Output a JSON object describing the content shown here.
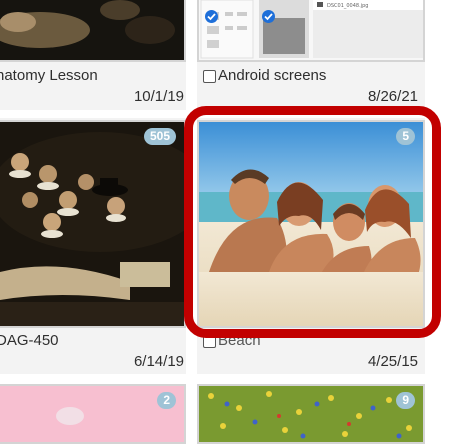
{
  "albums": [
    {
      "label": "natomy Lesson",
      "date": "10/1/19"
    },
    {
      "label": "Android screens",
      "date": "8/26/21"
    },
    {
      "label": "DAG-450",
      "date": "6/14/19",
      "count": "505"
    },
    {
      "label": "Beach",
      "date": "4/25/15",
      "count": "5"
    },
    {
      "label": "",
      "count": "2"
    },
    {
      "label": "",
      "count": "9"
    }
  ],
  "thumb_text": "DSC01_0048.jpg"
}
